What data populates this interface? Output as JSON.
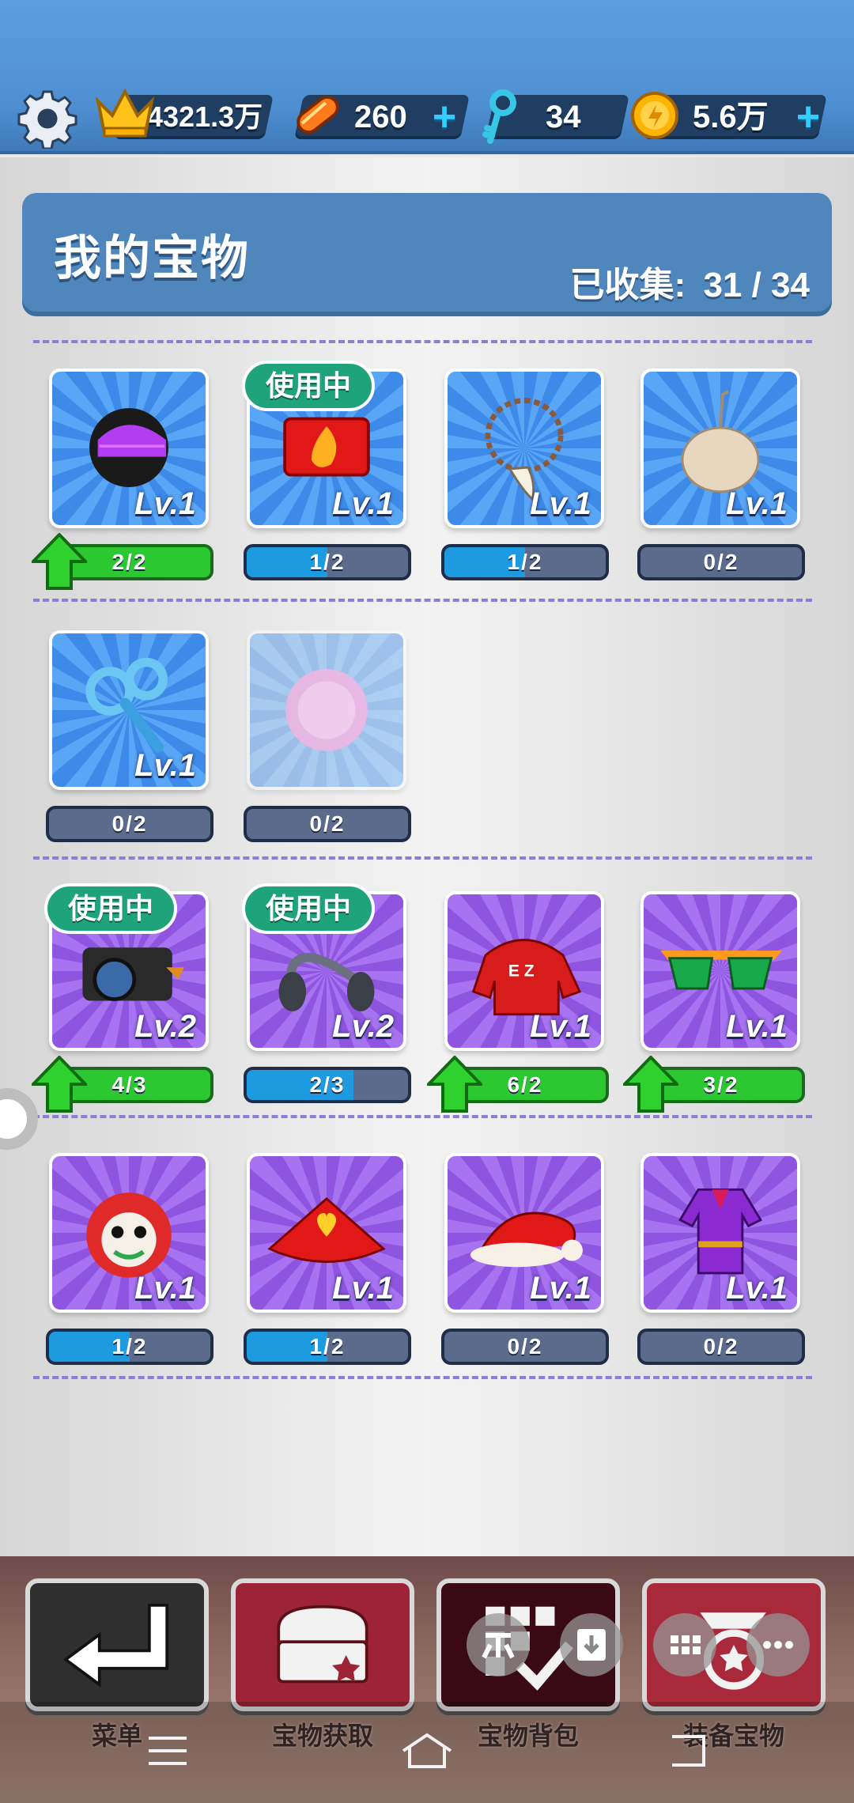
{
  "top_bar": {
    "settings_icon": "gear-icon",
    "crown_value": "4321.3万",
    "skateboard_value": "260",
    "key_value": "34",
    "coin_value": "5.6万",
    "plus": "+"
  },
  "header": {
    "title": "我的宝物",
    "collected_label": "已收集:",
    "collected_value": "31 / 34"
  },
  "in_use_label": "使用中",
  "items": [
    {
      "name": "helmet",
      "level": "Lv.1",
      "progress": "2/2",
      "fraction": 1.0,
      "upgrade": true,
      "in_use": false,
      "theme": "blue"
    },
    {
      "name": "fire-hat",
      "level": "Lv.1",
      "progress": "1/2",
      "fraction": 0.5,
      "upgrade": false,
      "in_use": true,
      "theme": "blue"
    },
    {
      "name": "tooth-necklace",
      "level": "Lv.1",
      "progress": "1/2",
      "fraction": 0.5,
      "upgrade": false,
      "in_use": false,
      "theme": "blue"
    },
    {
      "name": "bag",
      "level": "Lv.1",
      "progress": "0/2",
      "fraction": 0.0,
      "upgrade": false,
      "in_use": false,
      "theme": "blue"
    },
    {
      "name": "wind-up-key",
      "level": "Lv.1",
      "progress": "0/2",
      "fraction": 0.0,
      "upgrade": false,
      "in_use": false,
      "theme": "blue"
    },
    {
      "name": "pink-orb",
      "level": "",
      "progress": "0/2",
      "fraction": 0.0,
      "upgrade": false,
      "in_use": false,
      "theme": "blue",
      "locked": true
    },
    {
      "name": "camera",
      "level": "Lv.2",
      "progress": "4/3",
      "fraction": 1.0,
      "upgrade": true,
      "in_use": true,
      "theme": "purple"
    },
    {
      "name": "headphones",
      "level": "Lv.2",
      "progress": "2/3",
      "fraction": 0.66,
      "upgrade": false,
      "in_use": true,
      "theme": "purple"
    },
    {
      "name": "red-hoodie",
      "level": "Lv.1",
      "progress": "6/2",
      "fraction": 1.0,
      "upgrade": true,
      "in_use": false,
      "theme": "purple"
    },
    {
      "name": "sunglasses",
      "level": "Lv.1",
      "progress": "3/2",
      "fraction": 1.0,
      "upgrade": true,
      "in_use": false,
      "theme": "purple"
    },
    {
      "name": "lion-dance-head",
      "level": "Lv.1",
      "progress": "1/2",
      "fraction": 0.5,
      "upgrade": false,
      "in_use": false,
      "theme": "purple"
    },
    {
      "name": "heart-fan",
      "level": "Lv.1",
      "progress": "1/2",
      "fraction": 0.5,
      "upgrade": false,
      "in_use": false,
      "theme": "purple"
    },
    {
      "name": "santa-hat",
      "level": "Lv.1",
      "progress": "0/2",
      "fraction": 0.0,
      "upgrade": false,
      "in_use": false,
      "theme": "purple"
    },
    {
      "name": "qipao-dress",
      "level": "Lv.1",
      "progress": "0/2",
      "fraction": 0.0,
      "upgrade": false,
      "in_use": false,
      "theme": "purple"
    }
  ],
  "bottom_nav": [
    {
      "label": "菜单",
      "icon": "return-arrow-icon",
      "color": "#2f2f2f"
    },
    {
      "label": "宝物获取",
      "icon": "treasure-chest-icon",
      "color": "#9c2436"
    },
    {
      "label": "宝物背包",
      "icon": "grid-check-icon",
      "color": "#3a0a14"
    },
    {
      "label": "装备宝物",
      "icon": "equip-icon",
      "color": "#a82a3a"
    }
  ],
  "colors": {
    "top_bar": "#4e8fd2",
    "header": "#4f87bd",
    "in_use_badge": "#1fa37a",
    "progress_full": "#2bc831",
    "progress_partial": "#1e9ae0"
  }
}
